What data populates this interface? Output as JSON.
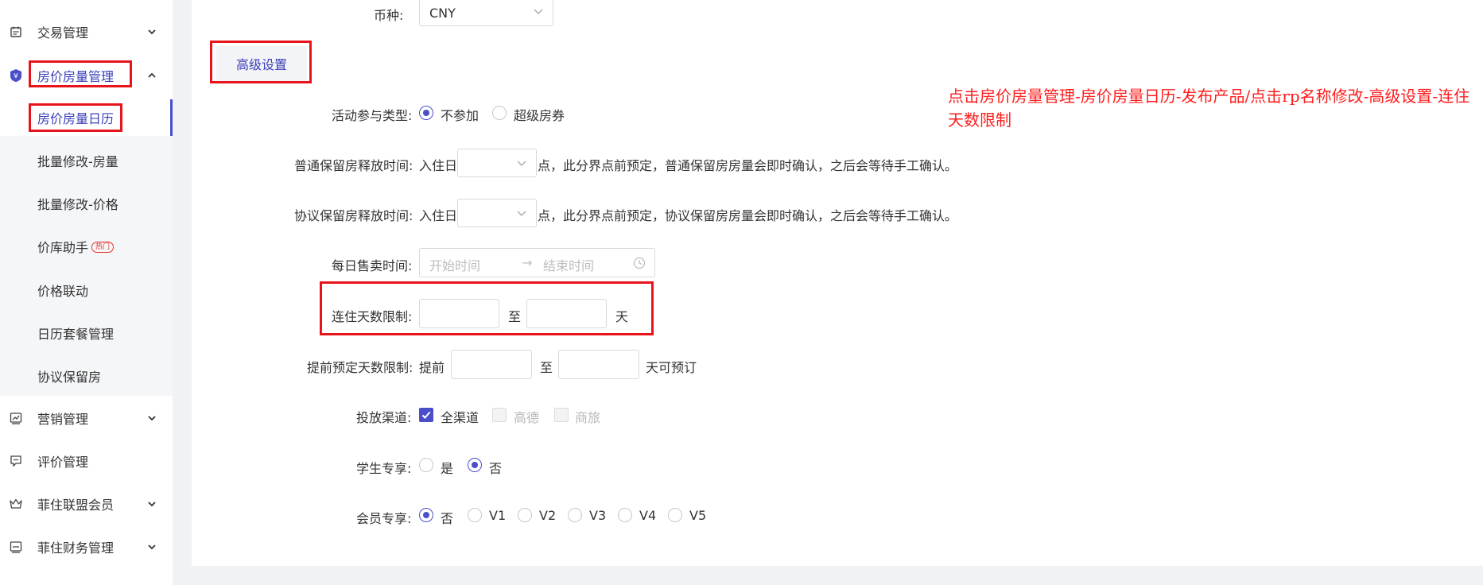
{
  "sidebar": {
    "items": [
      {
        "label": "交易管理",
        "icon": "calendar-icon",
        "expandable": true
      },
      {
        "label": "房价房量管理",
        "icon": "yen-shield-icon",
        "expandable": true,
        "expanded": true
      },
      {
        "label": "营销管理",
        "icon": "trend-chart-icon",
        "expandable": true
      },
      {
        "label": "评价管理",
        "icon": "comment-icon",
        "expandable": false
      },
      {
        "label": "菲住联盟会员",
        "icon": "crown-icon",
        "expandable": true
      },
      {
        "label": "菲住财务管理",
        "icon": "finance-icon",
        "expandable": true
      }
    ],
    "submenu": [
      {
        "label": "房价房量日历",
        "active": true
      },
      {
        "label": "批量修改-房量"
      },
      {
        "label": "批量修改-价格"
      },
      {
        "label": "价库助手",
        "badge": "热门"
      },
      {
        "label": "价格联动"
      },
      {
        "label": "日历套餐管理"
      },
      {
        "label": "协议保留房"
      }
    ]
  },
  "form": {
    "currency": {
      "label": "币种:",
      "value": "CNY"
    },
    "advanced_button": "高级设置",
    "activity_type": {
      "label": "活动参与类型:",
      "options": [
        "不参加",
        "超级房券"
      ],
      "selected": 0
    },
    "normal_release": {
      "label": "普通保留房释放时间:",
      "prefix": "入住日",
      "suffix": "点，此分界点前预定，普通保留房房量会即时确认，之后会等待手工确认。"
    },
    "agreement_release": {
      "label": "协议保留房释放时间:",
      "prefix": "入住日",
      "suffix": "点，此分界点前预定，协议保留房房量会即时确认，之后会等待手工确认。"
    },
    "daily_sale_time": {
      "label": "每日售卖时间:",
      "start_placeholder": "开始时间",
      "arrow": "→",
      "end_placeholder": "结束时间"
    },
    "stay_days": {
      "label": "连住天数限制:",
      "to": "至",
      "unit": "天"
    },
    "advance_days": {
      "label": "提前预定天数限制:",
      "prefix": "提前",
      "to": "至",
      "unit": "天可预订"
    },
    "channels": {
      "label": "投放渠道:",
      "options": [
        {
          "label": "全渠道",
          "checked": true,
          "disabled": false
        },
        {
          "label": "高德",
          "checked": false,
          "disabled": true
        },
        {
          "label": "商旅",
          "checked": false,
          "disabled": true
        }
      ]
    },
    "student": {
      "label": "学生专享:",
      "options": [
        "是",
        "否"
      ],
      "selected": 1
    },
    "member": {
      "label": "会员专享:",
      "options": [
        "否",
        "V1",
        "V2",
        "V3",
        "V4",
        "V5"
      ],
      "selected": 0
    }
  },
  "annotation": "点击房价房量管理-房价房量日历-发布产品/点击rp名称修改-高级设置-连住天数限制",
  "colors": {
    "accent": "#4a4fc9",
    "highlight_box": "#e8141b",
    "annotation": "#ff1d1d"
  }
}
